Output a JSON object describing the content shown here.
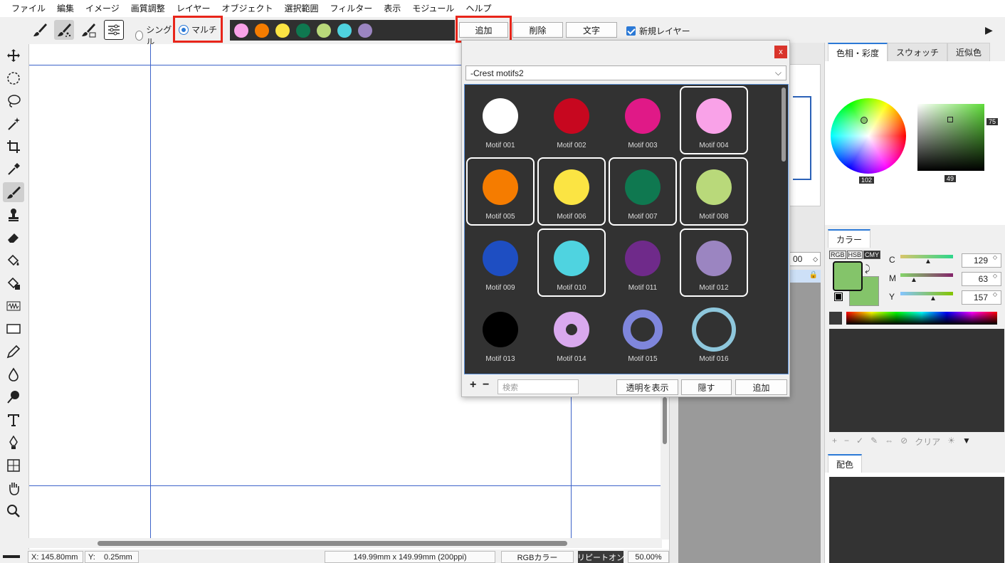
{
  "menu": [
    "ファイル",
    "編集",
    "イメージ",
    "画質調整",
    "レイヤー",
    "オブジェクト",
    "選択範囲",
    "フィルター",
    "表示",
    "モジュール",
    "ヘルプ"
  ],
  "toolbar": {
    "single_label": "シングル",
    "multi_label": "マルチ",
    "add_label": "追加",
    "delete_label": "削除",
    "text_label": "文字",
    "new_layer_label": "新規レイヤー",
    "swatches": [
      "#f9a2e8",
      "#f57c00",
      "#fbe443",
      "#0f7850",
      "#b9d97a",
      "#4fd3e0",
      "#9b85c1"
    ]
  },
  "dialog": {
    "close_label": "x",
    "set_name": "-Crest motifs2",
    "search_placeholder": "検索",
    "show_transparency_label": "透明を表示",
    "hide_label": "隠す",
    "add_label": "追加",
    "plus_label": "+",
    "minus_label": "−",
    "motifs": [
      {
        "label": "Motif 001",
        "color": "#ffffff",
        "style": "solid",
        "selected": false
      },
      {
        "label": "Motif 002",
        "color": "#c7071f",
        "style": "solid",
        "selected": false
      },
      {
        "label": "Motif 003",
        "color": "#e01987",
        "style": "solid",
        "selected": false
      },
      {
        "label": "Motif 004",
        "color": "#f9a2e8",
        "style": "solid",
        "selected": true
      },
      {
        "label": "Motif 005",
        "color": "#f57c00",
        "style": "solid",
        "selected": true
      },
      {
        "label": "Motif 006",
        "color": "#fbe443",
        "style": "solid",
        "selected": true
      },
      {
        "label": "Motif 007",
        "color": "#0f7850",
        "style": "solid",
        "selected": true
      },
      {
        "label": "Motif 008",
        "color": "#b9d97a",
        "style": "solid",
        "selected": true
      },
      {
        "label": "Motif 009",
        "color": "#1e4ec2",
        "style": "solid",
        "selected": false
      },
      {
        "label": "Motif 010",
        "color": "#4fd3e0",
        "style": "solid",
        "selected": true
      },
      {
        "label": "Motif 011",
        "color": "#6f2a8a",
        "style": "solid",
        "selected": false
      },
      {
        "label": "Motif 012",
        "color": "#9b85c1",
        "style": "solid",
        "selected": true
      },
      {
        "label": "Motif 013",
        "color": "#000000",
        "style": "solid",
        "selected": false
      },
      {
        "label": "Motif 014",
        "color": "#d9a9ee",
        "style": "ring-thick",
        "selected": false
      },
      {
        "label": "Motif 015",
        "color": "#7f86dc",
        "style": "ring-medium",
        "selected": false
      },
      {
        "label": "Motif 016",
        "color": "#8ec7dc",
        "style": "ring-thin",
        "selected": false
      }
    ]
  },
  "right_panel": {
    "tabs_top": [
      "色相・彩度",
      "スウォッチ",
      "近似色"
    ],
    "hue_value": "102",
    "saturation_value": "75",
    "brightness_value": "49",
    "color_tab": "カラー",
    "mode_tabs": [
      "RGB",
      "HSB",
      "CMY"
    ],
    "current_color": "#84c46a",
    "sliders": [
      {
        "label": "C",
        "value": "129"
      },
      {
        "label": "M",
        "value": "63"
      },
      {
        "label": "Y",
        "value": "157"
      }
    ],
    "swatch_tools_clear": "クリア",
    "harmony_tab": "配色"
  },
  "middle_panel": {
    "opacity_value": "00"
  },
  "status": {
    "x_label": "X:",
    "x_value": "145.80mm",
    "y_label": "Y:",
    "y_value": "0.25mm",
    "size": "149.99mm x 149.99mm (200ppi)",
    "color_mode": "RGBカラー",
    "repeat": "リピートオン",
    "zoom": "50.00%"
  }
}
